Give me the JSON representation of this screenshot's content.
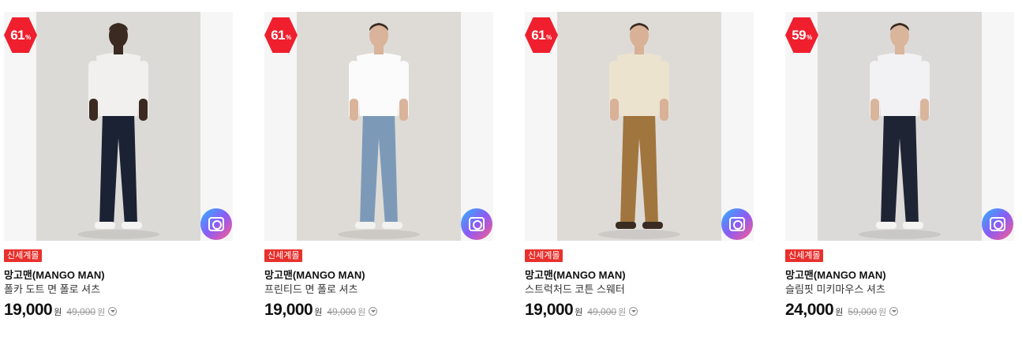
{
  "products": [
    {
      "discount": "61",
      "discount_unit": "%",
      "store_tag": "신세계몰",
      "brand": "망고맨(MANGO MAN)",
      "name": "폴카 도트 면 폴로 셔츠",
      "price": "19,000",
      "currency": "원",
      "original_price": "49,000",
      "original_currency": "원",
      "colors": {
        "top": "#f1f0ee",
        "bottom": "#1b2233",
        "skin": "#3b2a22",
        "bg": "#dcdad6",
        "shoe": "#f4f4f2"
      }
    },
    {
      "discount": "61",
      "discount_unit": "%",
      "store_tag": "신세계몰",
      "brand": "망고맨(MANGO MAN)",
      "name": "프린티드 면 폴로 셔츠",
      "price": "19,000",
      "currency": "원",
      "original_price": "49,000",
      "original_currency": "원",
      "colors": {
        "top": "#fbfbfb",
        "bottom": "#7c9ab8",
        "skin": "#d9b39a",
        "bg": "#dedbd6",
        "shoe": "#f2f2f0"
      }
    },
    {
      "discount": "61",
      "discount_unit": "%",
      "store_tag": "신세계몰",
      "brand": "망고맨(MANGO MAN)",
      "name": "스트럭처드 코튼 스웨터",
      "price": "19,000",
      "currency": "원",
      "original_price": "49,000",
      "original_currency": "원",
      "colors": {
        "top": "#ece3cf",
        "bottom": "#a1753e",
        "skin": "#d8b196",
        "bg": "#dedbd7",
        "shoe": "#3a2c22"
      }
    },
    {
      "discount": "59",
      "discount_unit": "%",
      "store_tag": "신세계몰",
      "brand": "망고맨(MANGO MAN)",
      "name": "슬림핏 미키마우스 셔츠",
      "price": "24,000",
      "currency": "원",
      "original_price": "59,000",
      "original_currency": "원",
      "colors": {
        "top": "#f2f2f4",
        "bottom": "#1e2433",
        "skin": "#d9b59c",
        "bg": "#dcdad8",
        "shoe": "#f4f4f2"
      }
    }
  ]
}
